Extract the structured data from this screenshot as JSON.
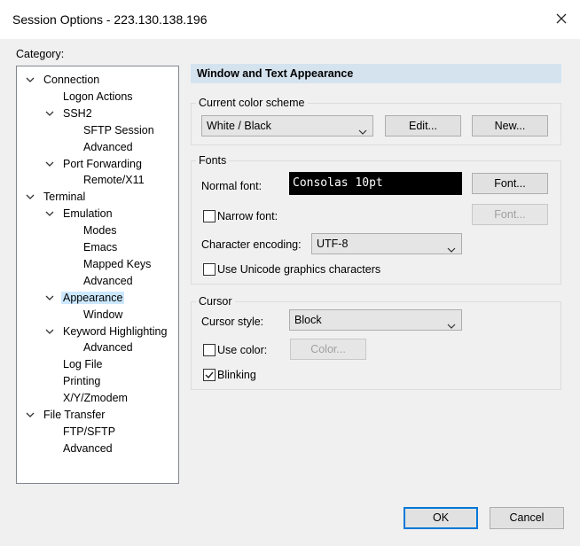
{
  "window": {
    "title": "Session Options - 223.130.138.196"
  },
  "category_label": "Category:",
  "tree": [
    {
      "label": "Connection",
      "level": 0,
      "expanded": true
    },
    {
      "label": "Logon Actions",
      "level": 1
    },
    {
      "label": "SSH2",
      "level": 1,
      "expanded": true
    },
    {
      "label": "SFTP Session",
      "level": 2
    },
    {
      "label": "Advanced",
      "level": 2
    },
    {
      "label": "Port Forwarding",
      "level": 1,
      "expanded": true
    },
    {
      "label": "Remote/X11",
      "level": 2
    },
    {
      "label": "Terminal",
      "level": 0,
      "expanded": true
    },
    {
      "label": "Emulation",
      "level": 1,
      "expanded": true
    },
    {
      "label": "Modes",
      "level": 2
    },
    {
      "label": "Emacs",
      "level": 2
    },
    {
      "label": "Mapped Keys",
      "level": 2
    },
    {
      "label": "Advanced",
      "level": 2
    },
    {
      "label": "Appearance",
      "level": 1,
      "expanded": true,
      "selected": true
    },
    {
      "label": "Window",
      "level": 2
    },
    {
      "label": "Keyword Highlighting",
      "level": 1,
      "expanded": true
    },
    {
      "label": "Advanced",
      "level": 2
    },
    {
      "label": "Log File",
      "level": 1
    },
    {
      "label": "Printing",
      "level": 1
    },
    {
      "label": "X/Y/Zmodem",
      "level": 1
    },
    {
      "label": "File Transfer",
      "level": 0,
      "expanded": true
    },
    {
      "label": "FTP/SFTP",
      "level": 1
    },
    {
      "label": "Advanced",
      "level": 1
    }
  ],
  "panel": {
    "header": "Window and Text Appearance",
    "color_scheme": {
      "group_label": "Current color scheme",
      "selected": "White / Black",
      "edit_button": "Edit...",
      "new_button": "New..."
    },
    "fonts": {
      "group_label": "Fonts",
      "normal_font_label": "Normal font:",
      "normal_font_preview": "Consolas 10pt",
      "font_button": "Font...",
      "narrow_font_label": "Narrow font:",
      "narrow_font_checked": false,
      "narrow_font_button": "Font...",
      "encoding_label": "Character encoding:",
      "encoding_value": "UTF-8",
      "unicode_graphics_label": "Use Unicode graphics characters",
      "unicode_graphics_checked": false
    },
    "cursor": {
      "group_label": "Cursor",
      "style_label": "Cursor style:",
      "style_value": "Block",
      "use_color_label": "Use color:",
      "use_color_checked": false,
      "color_button": "Color...",
      "blinking_label": "Blinking",
      "blinking_checked": true
    }
  },
  "footer": {
    "ok_button": "OK",
    "cancel_button": "Cancel"
  }
}
